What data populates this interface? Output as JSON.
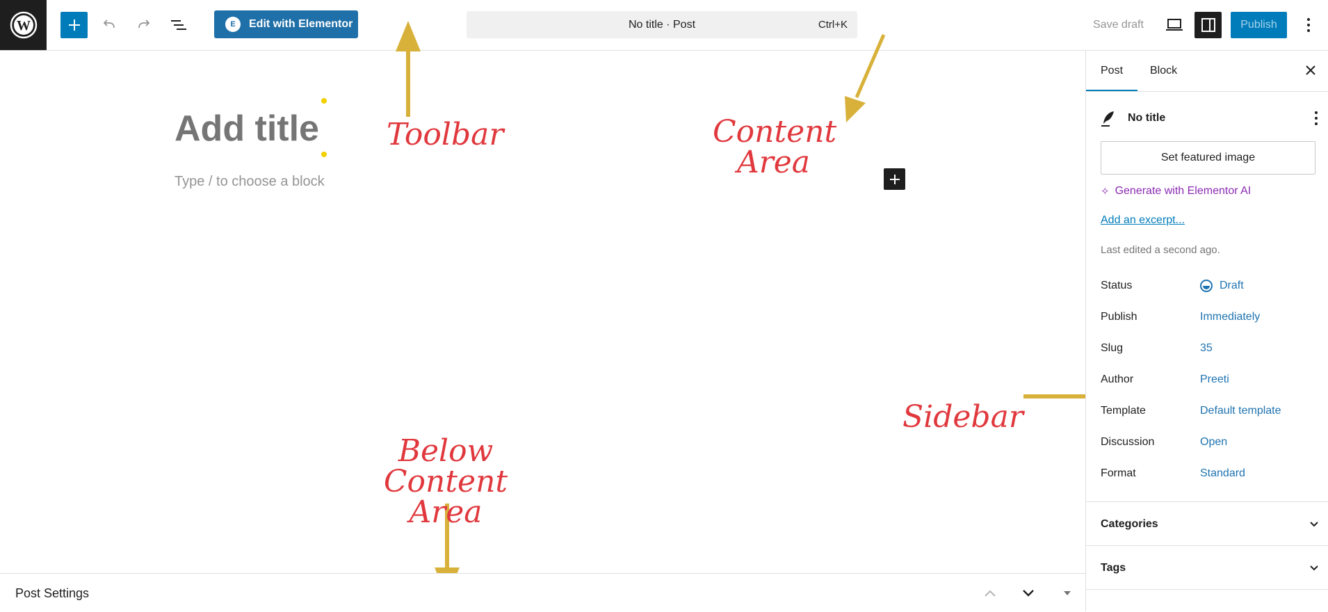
{
  "toolbar": {
    "wp_logo_icon": "wordpress-logo-icon",
    "inserter_icon": "plus-icon",
    "undo_icon": "undo-icon",
    "redo_icon": "redo-icon",
    "document_overview_icon": "list-view-icon",
    "elementor_label": "Edit with Elementor",
    "command_center_title": "No title · Post",
    "command_center_shortcut": "Ctrl+K",
    "save_draft_label": "Save draft",
    "preview_icon": "desktop-preview-icon",
    "settings_toggle_icon": "sidebar-toggle-icon",
    "publish_label": "Publish",
    "options_icon": "kebab-menu-icon",
    "accent_color": "#007cba",
    "elementor_color": "#1f6fa8"
  },
  "editor": {
    "title_placeholder": "Add title",
    "block_placeholder": "Type / to choose a block",
    "add_block_icon": "plus-icon"
  },
  "annotations": {
    "toolbar": "Toolbar",
    "content_area_line1": "Content",
    "content_area_line2": "Area",
    "sidebar": "Sidebar",
    "below_content_line1": "Below Content",
    "below_content_line2": "Area",
    "text_color": "#e0383d",
    "arrow_color": "#d8b13a"
  },
  "bottom_bar": {
    "label": "Post Settings"
  },
  "sidebar": {
    "tabs": [
      {
        "label": "Post",
        "active": true
      },
      {
        "label": "Block",
        "active": false
      }
    ],
    "post_title": "No title",
    "featured_image_label": "Set featured image",
    "generate_ai_label": "Generate with Elementor AI",
    "excerpt_label": "Add an excerpt...",
    "last_edited": "Last edited a second ago.",
    "meta": [
      {
        "label": "Status",
        "value": "Draft"
      },
      {
        "label": "Publish",
        "value": "Immediately"
      },
      {
        "label": "Slug",
        "value": "35"
      },
      {
        "label": "Author",
        "value": "Preeti"
      },
      {
        "label": "Template",
        "value": "Default template"
      },
      {
        "label": "Discussion",
        "value": "Open"
      },
      {
        "label": "Format",
        "value": "Standard"
      }
    ],
    "panels": [
      {
        "label": "Categories"
      },
      {
        "label": "Tags"
      }
    ]
  }
}
